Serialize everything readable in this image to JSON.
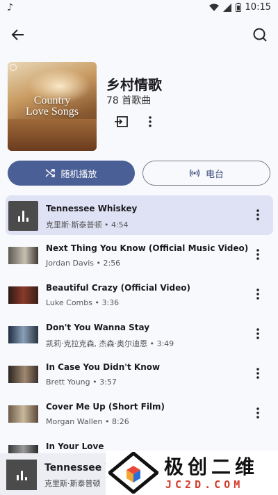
{
  "status_bar": {
    "time": "10:15",
    "notif_icon": "music-note-icon"
  },
  "playlist": {
    "title": "乡村情歌",
    "count": "78 首歌曲",
    "art_line1": "Country",
    "art_line2": "Love Songs"
  },
  "actions": {
    "shuffle_label": "随机播放",
    "radio_label": "电台"
  },
  "songs": [
    {
      "title": "Tennessee Whiskey",
      "subtitle": "克里斯·斯泰普顿 • 4:54",
      "playing": true
    },
    {
      "title": "Next Thing You Know (Official Music Video)",
      "subtitle": "Jordan Davis • 2:56"
    },
    {
      "title": "Beautiful Crazy (Official Video)",
      "subtitle": "Luke Combs • 3:36"
    },
    {
      "title": "Don't You Wanna Stay",
      "subtitle": "凯莉·克拉克森, 杰森·奥尔迪恩 • 3:49"
    },
    {
      "title": "In Case You Didn't Know",
      "subtitle": "Brett Young • 3:57"
    },
    {
      "title": "Cover Me Up (Short Film)",
      "subtitle": "Morgan Wallen • 8:26"
    },
    {
      "title": "In Your Love",
      "subtitle": ""
    }
  ],
  "mini_player": {
    "title": "Tennessee W",
    "subtitle": "克里斯·斯泰普顿"
  },
  "watermark": {
    "text": "极创二维",
    "domain": "JC2D.COM"
  },
  "colors": {
    "accent": "#4a5f96",
    "active_row": "#dfe2f5",
    "background": "#f8f9fc"
  }
}
